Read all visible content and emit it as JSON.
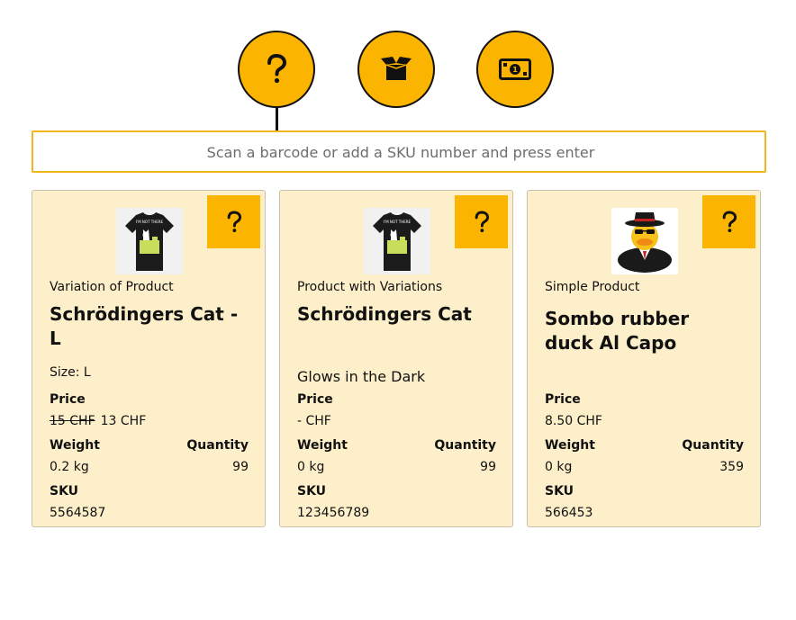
{
  "toolbar": {
    "buttons": [
      {
        "icon": "question-icon",
        "active": true
      },
      {
        "icon": "open-box-icon"
      },
      {
        "icon": "money-bill-icon",
        "text": "1"
      }
    ]
  },
  "scan": {
    "placeholder": "Scan a barcode or add a SKU number and press enter",
    "value": ""
  },
  "colors": {
    "accent": "#fbb400",
    "card_bg": "#fdefc9",
    "input_border": "#f2b51a"
  },
  "products": [
    {
      "type": "Variation of Product",
      "name": "Schrödingers Cat - L",
      "detail": "Size: L",
      "price_label": "Price",
      "price_old": "15 CHF",
      "price": "13 CHF",
      "weight_label": "Weight",
      "weight": "0.2 kg",
      "quantity_label": "Quantity",
      "quantity": "99",
      "sku_label": "SKU",
      "sku": "5564587",
      "image": "black-tshirt-cat-image",
      "shirt_text": "I'M NOT THERE"
    },
    {
      "type": "Product with Variations",
      "name": "Schrödingers Cat",
      "detail": "Glows in the Dark",
      "price_label": "Price",
      "price": "- CHF",
      "weight_label": "Weight",
      "weight": "0 kg",
      "quantity_label": "Quantity",
      "quantity": "99",
      "sku_label": "SKU",
      "sku": "123456789",
      "image": "black-tshirt-cat-image",
      "shirt_text": "I'M NOT THERE"
    },
    {
      "type": "Simple Product",
      "name": "Sombo rubber duck Al Capo",
      "detail": "",
      "price_label": "Price",
      "price": "8.50 CHF",
      "weight_label": "Weight",
      "weight": "0 kg",
      "quantity_label": "Quantity",
      "quantity": "359",
      "sku_label": "SKU",
      "sku": "566453",
      "image": "gangster-rubber-duck-image"
    }
  ]
}
